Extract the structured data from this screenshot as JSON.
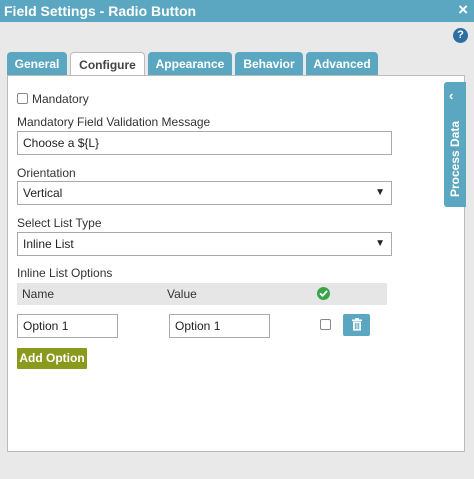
{
  "window": {
    "title": "Field Settings - Radio Button",
    "close_glyph": "×",
    "help_glyph": "?"
  },
  "tabs": [
    {
      "label": "General"
    },
    {
      "label": "Configure"
    },
    {
      "label": "Appearance"
    },
    {
      "label": "Behavior"
    },
    {
      "label": "Advanced"
    }
  ],
  "active_tab": "Configure",
  "side_panel": {
    "label": "Process Data",
    "chevron": "‹"
  },
  "form": {
    "mandatory_label": "Mandatory",
    "mandatory_checked": false,
    "validation_label": "Mandatory Field Validation Message",
    "validation_value": "Choose a ${L}",
    "orientation_label": "Orientation",
    "orientation_value": "Vertical",
    "list_type_label": "Select List Type",
    "list_type_value": "Inline List",
    "inline_options_label": "Inline List Options",
    "columns": {
      "name": "Name",
      "value": "Value"
    },
    "options": [
      {
        "name": "Option 1",
        "value": "Option 1",
        "default_checked": false
      }
    ],
    "add_option_label": "Add Option"
  },
  "colors": {
    "titlebar": "#5ba7c1",
    "tab": "#5ba7c1",
    "add_button": "#8a9a1c",
    "ok_icon": "#3aa44a",
    "help_icon": "#2d6fa3"
  },
  "icons": {
    "close": "close-icon",
    "help": "help-icon",
    "chevron": "chevron-left-icon",
    "ok": "check-circle-icon",
    "delete": "trash-icon"
  }
}
